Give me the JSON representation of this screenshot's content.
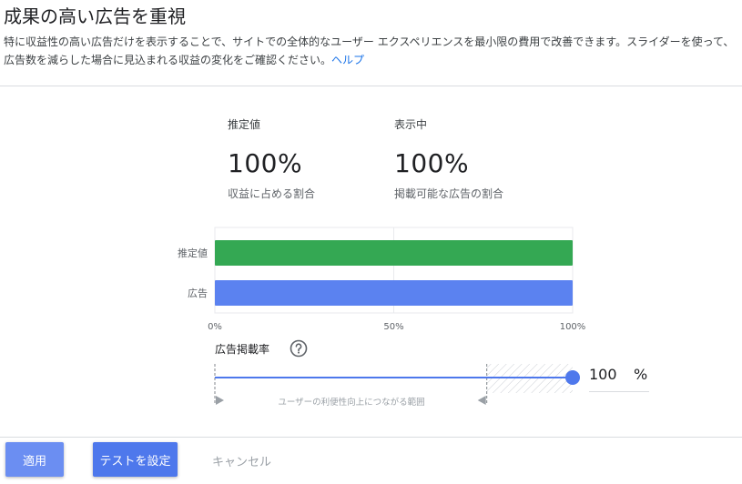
{
  "header": {
    "title": "成果の高い広告を重視",
    "description": "特に収益性の高い広告だけを表示することで、サイトでの全体的なユーザー エクスペリエンスを最小限の費用で改善できます。スライダーを使って、広告数を減らした場合に見込まれる収益の変化をご確認ください。",
    "help_link": "ヘルプ"
  },
  "metrics": [
    {
      "label": "推定値",
      "value": "100%",
      "sub": "収益に占める割合"
    },
    {
      "label": "表示中",
      "value": "100%",
      "sub": "掲載可能な広告の割合"
    }
  ],
  "chart_data": {
    "type": "bar",
    "orientation": "horizontal",
    "categories": [
      "推定値",
      "広告"
    ],
    "values": [
      100,
      100
    ],
    "colors": [
      "#34a853",
      "#5b82f0"
    ],
    "xticks": [
      "0%",
      "50%",
      "100%"
    ],
    "xlim": [
      0,
      100
    ],
    "grid": true
  },
  "slider": {
    "title": "広告掲載率",
    "help_icon": "help-circle-icon",
    "value": 100,
    "value_text": "100",
    "unit": "%",
    "recommended_range": [
      0,
      76
    ],
    "range_label": "ユーザーの利便性向上につながる範囲",
    "accent": "#4e78ec"
  },
  "footer": {
    "apply": "適用",
    "test": "テストを設定",
    "cancel": "キャンセル"
  }
}
